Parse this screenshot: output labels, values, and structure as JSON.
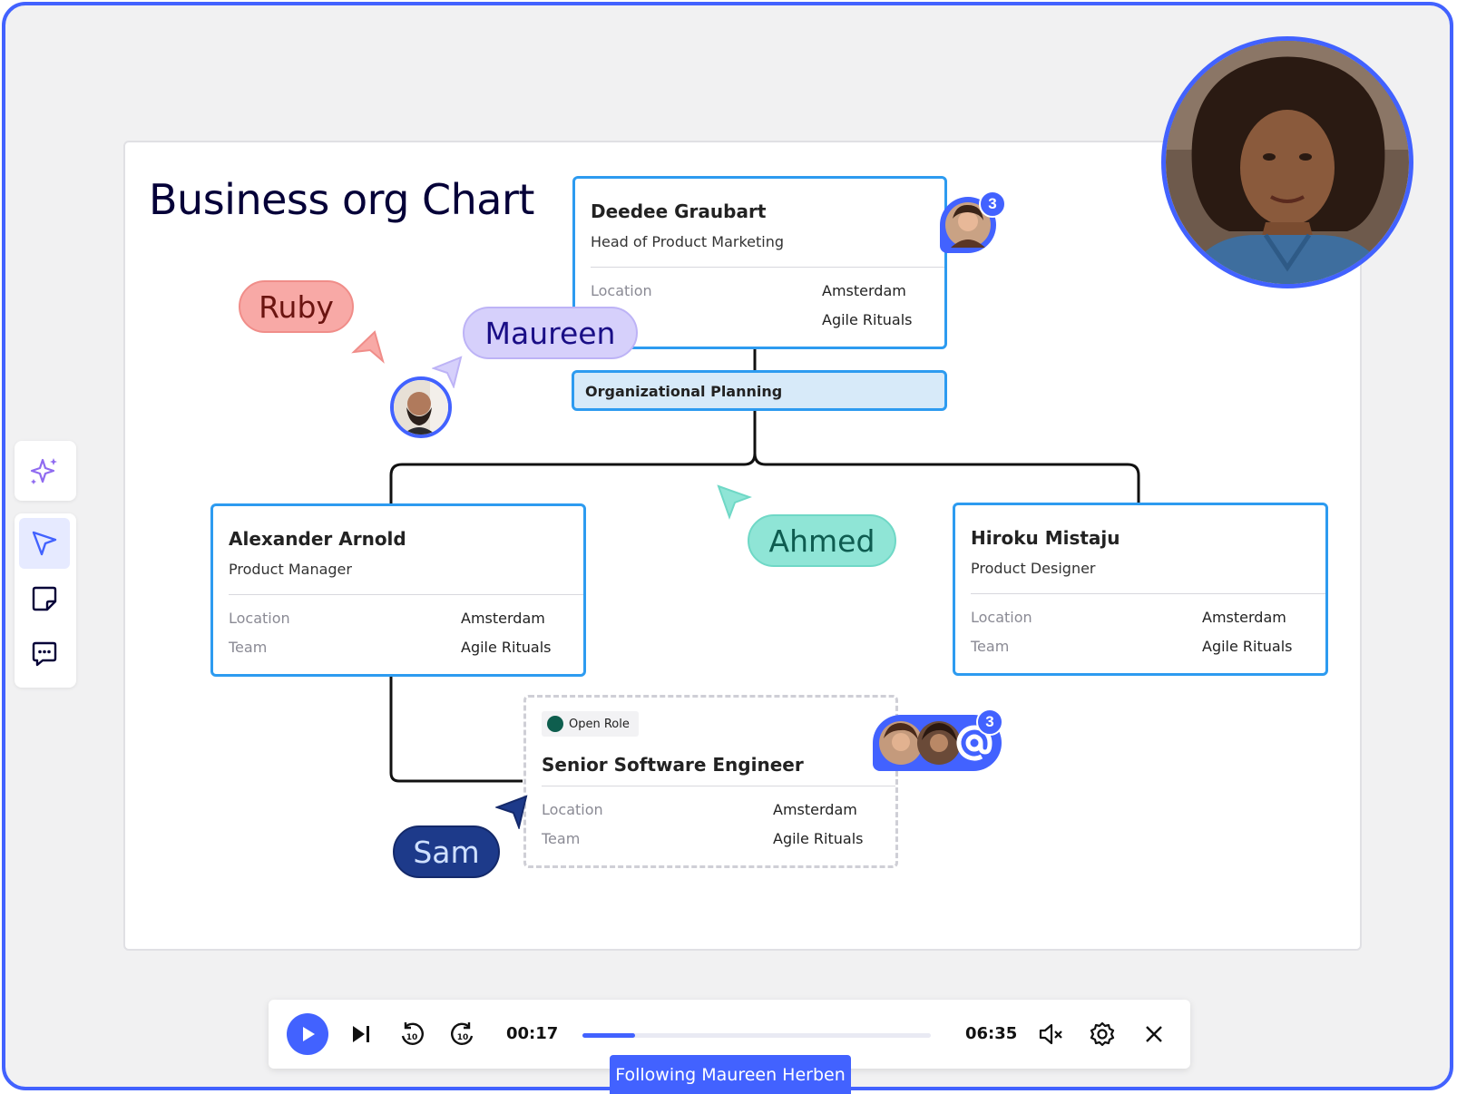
{
  "board": {
    "title": "Business org Chart"
  },
  "cards": {
    "head": {
      "name": "Deedee Graubart",
      "role": "Head of Product Marketing",
      "location_label": "Location",
      "location_value": "Amsterdam",
      "team_value": "Agile Rituals",
      "comment_count": "3"
    },
    "planning": {
      "label": "Organizational Planning"
    },
    "alexander": {
      "name": "Alexander Arnold",
      "role": "Product Manager",
      "location_label": "Location",
      "location_value": "Amsterdam",
      "team_label": "Team",
      "team_value": "Agile Rituals"
    },
    "hiroku": {
      "name": "Hiroku Mistaju",
      "role": "Product Designer",
      "location_label": "Location",
      "location_value": "Amsterdam",
      "team_label": "Team",
      "team_value": "Agile Rituals"
    },
    "open_role": {
      "badge": "Open Role",
      "name": "Senior Software Engineer",
      "location_label": "Location",
      "location_value": "Amsterdam",
      "team_label": "Team",
      "team_value": "Agile Rituals",
      "mention_count": "3"
    }
  },
  "collaborators": {
    "ruby": {
      "label": "Ruby",
      "color": "#F8A9A6",
      "text_color": "#6B1410"
    },
    "maureen": {
      "label": "Maureen",
      "color": "#D6D0FB",
      "text_color": "#1A0E86"
    },
    "ahmed": {
      "label": "Ahmed",
      "color": "#8FE5D6",
      "text_color": "#0E5C50"
    },
    "sam": {
      "label": "Sam",
      "color": "#1D3A8A",
      "text_color": "#CFE0FF"
    }
  },
  "left_toolbar": {
    "items": [
      "ai-sparkle-icon",
      "select-cursor-icon",
      "sticky-note-icon",
      "comment-icon"
    ]
  },
  "player": {
    "current_time": "00:17",
    "total_time": "06:35",
    "progress": 0.15,
    "following_label": "Following Maureen Herben"
  },
  "colors": {
    "accent": "#4262FF",
    "card_border": "#2D9BF0",
    "canvas": "#F1F1F2"
  }
}
